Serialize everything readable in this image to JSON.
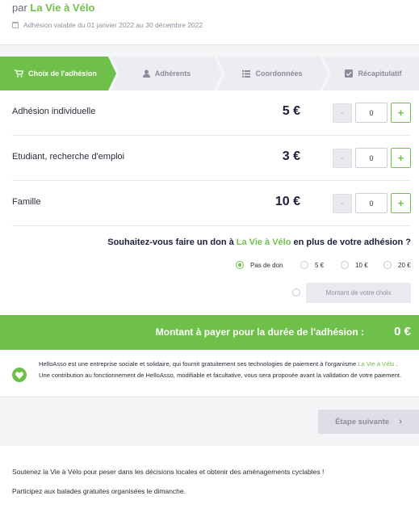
{
  "header": {
    "by_prefix": "par",
    "org_name": "La Vie à Vélo",
    "validity": "Adhésion valable du 01 janvier 2022 au 30 décembre 2022"
  },
  "steps": [
    {
      "label": "Choix de l'adhésion",
      "icon": "cart-icon",
      "active": true
    },
    {
      "label": "Adhérents",
      "icon": "user-icon",
      "active": false
    },
    {
      "label": "Coordonnées",
      "icon": "list-icon",
      "active": false
    },
    {
      "label": "Récapitulatif",
      "icon": "checkbox-icon",
      "active": false
    }
  ],
  "memberships": [
    {
      "label": "Adhésion individuelle",
      "price": "5 €",
      "quantity": "0",
      "minus": "-",
      "plus": "+"
    },
    {
      "label": "Etudiant, recherche d'emploi",
      "price": "3 €",
      "quantity": "0",
      "minus": "-",
      "plus": "+"
    },
    {
      "label": "Famille",
      "price": "10 €",
      "quantity": "0",
      "minus": "-",
      "plus": "+"
    }
  ],
  "donation": {
    "question_before": "Souhaitez-vous faire un don à",
    "question_org": "La Vie à Vélo",
    "question_after": "en plus de votre adhésion ?",
    "options": [
      {
        "label": "Pas de don",
        "selected": true
      },
      {
        "label": "5 €",
        "selected": false
      },
      {
        "label": "10 €",
        "selected": false
      },
      {
        "label": "20 €",
        "selected": false
      }
    ],
    "custom_placeholder": "Montant de votre choix"
  },
  "total": {
    "label": "Montant à payer pour la durée de l'adhésion :",
    "amount": "0 €"
  },
  "info": {
    "text_before": "HelloAsso est une entreprise sociale et solidaire, qui fournit gratuitement ses technologies de paiement à l'organisme",
    "org": "La Vie à Vélo",
    "text_after": ". Une contribution au fonctionnement de HelloAsso, modifiable et facultative, vous sera proposée avant la validation de votre paiement."
  },
  "next_button": {
    "label": "Étape suivante",
    "chevron": "›"
  },
  "footer": {
    "line1": "Soutenez la Vie à Vélo pour peser dans les décisions locales et obtenir des aménagements cyclables !",
    "line2": "Participez aux balades gratuites organisées le dimanche."
  },
  "colors": {
    "accent": "#6fc04a",
    "dark_text": "#1c1f3c",
    "inactive_step": "#ececf1",
    "background": "#f4f5f7"
  }
}
